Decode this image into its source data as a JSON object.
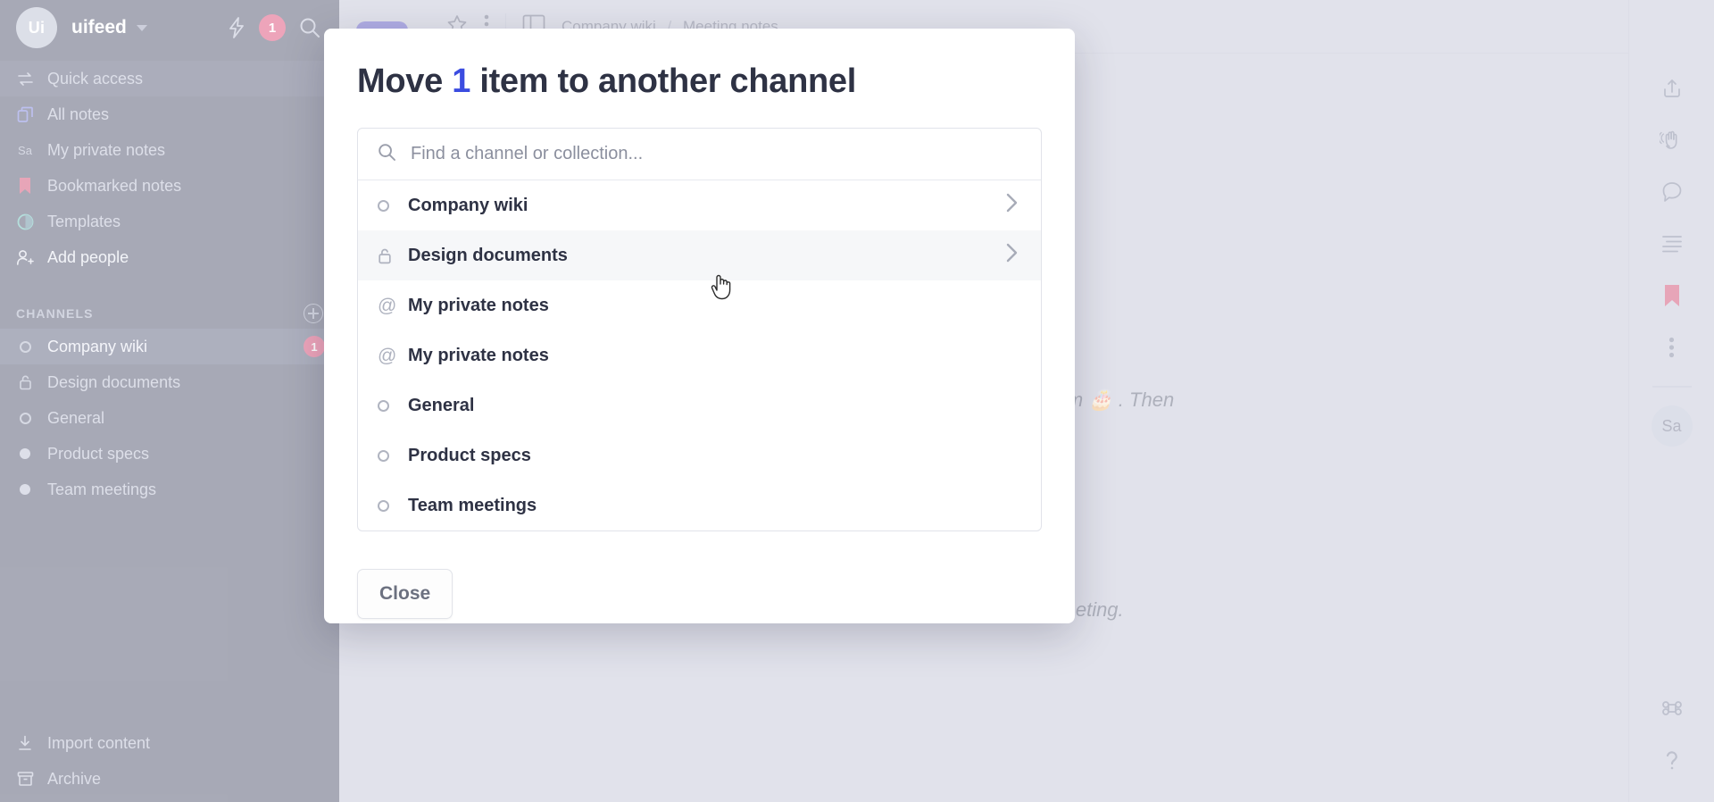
{
  "workspace": {
    "avatar_initials": "Ui",
    "name": "uifeed",
    "notification_count": "1",
    "caret_icon": "chevron-down-icon",
    "bolt_icon": "lightning-bolt-icon",
    "search_icon": "search-icon"
  },
  "sidebar": {
    "nav_items": [
      {
        "label": "Quick access",
        "icon": "quick-access-arrows-icon",
        "active": true
      },
      {
        "label": "All notes",
        "icon": "copy-notes-icon",
        "active": false
      },
      {
        "label": "My private notes",
        "icon": "sa-avatar-icon",
        "active": false
      },
      {
        "label": "Bookmarked notes",
        "icon": "bookmark-icon",
        "active": false
      },
      {
        "label": "Templates",
        "icon": "templates-circle-icon",
        "active": false
      },
      {
        "label": "Add people",
        "icon": "add-person-icon",
        "active": false
      }
    ],
    "channels_header": "CHANNELS",
    "add_channel_icon": "plus-circle-icon",
    "channels": [
      {
        "label": "Company wiki",
        "icon": "ring-icon",
        "active": true,
        "badge": "1"
      },
      {
        "label": "Design documents",
        "icon": "lock-icon",
        "active": false,
        "badge": ""
      },
      {
        "label": "General",
        "icon": "ring-icon",
        "active": false,
        "badge": ""
      },
      {
        "label": "Product specs",
        "icon": "dot-icon",
        "active": false,
        "badge": ""
      },
      {
        "label": "Team meetings",
        "icon": "dot-icon",
        "active": false,
        "badge": ""
      }
    ],
    "bottom_items": [
      {
        "label": "Import content",
        "icon": "download-icon"
      },
      {
        "label": "Archive",
        "icon": "archive-box-icon"
      }
    ]
  },
  "note_rail": {
    "new_note_icon": "new-note-plus-icon",
    "add_to_collection_icon": "add-to-collection-icon",
    "badge": "1"
  },
  "main": {
    "title": "Company wiki",
    "breadcrumb_root": "Company wiki",
    "breadcrumb_sep": "/",
    "breadcrumb_leaf": "Meeting notes",
    "body_line_1": "nday cake for @tom 🎂 . Then",
    "body_line_2": "d in the meeting."
  },
  "right_rail": {
    "icons": [
      "share-upload-icon",
      "wave-hand-icon",
      "comment-bubble-icon",
      "list-lines-icon",
      "bookmark-filled-icon",
      "more-vertical-dots-icon"
    ],
    "avatar_initials": "Sa",
    "command_icon": "command-key-icon",
    "help_icon": "question-mark-icon"
  },
  "modal": {
    "title_prefix": "Move",
    "title_count": "1",
    "title_suffix": "item to another channel",
    "search": {
      "placeholder": "Find a channel or collection...",
      "value": "",
      "icon": "search-icon"
    },
    "rows": [
      {
        "label": "Company wiki",
        "icon": "ring-icon",
        "chevron": true,
        "hover": false
      },
      {
        "label": "Design documents",
        "icon": "lock-icon",
        "chevron": true,
        "hover": true
      },
      {
        "label": "My private notes",
        "icon": "at-icon",
        "chevron": false,
        "hover": false
      },
      {
        "label": "My private notes",
        "icon": "at-icon",
        "chevron": false,
        "hover": false
      },
      {
        "label": "General",
        "icon": "ring-icon",
        "chevron": false,
        "hover": false
      },
      {
        "label": "Product specs",
        "icon": "ring-icon",
        "chevron": false,
        "hover": false
      },
      {
        "label": "Team meetings",
        "icon": "ring-icon",
        "chevron": false,
        "hover": false
      }
    ],
    "close_label": "Close"
  },
  "colors": {
    "sidebar_bg": "#252a4a",
    "accent_blue": "#3b4ce0",
    "badge_crimson": "#d31c53",
    "new_note_blue": "#3730b8",
    "content_bg": "#b3b7ce"
  }
}
